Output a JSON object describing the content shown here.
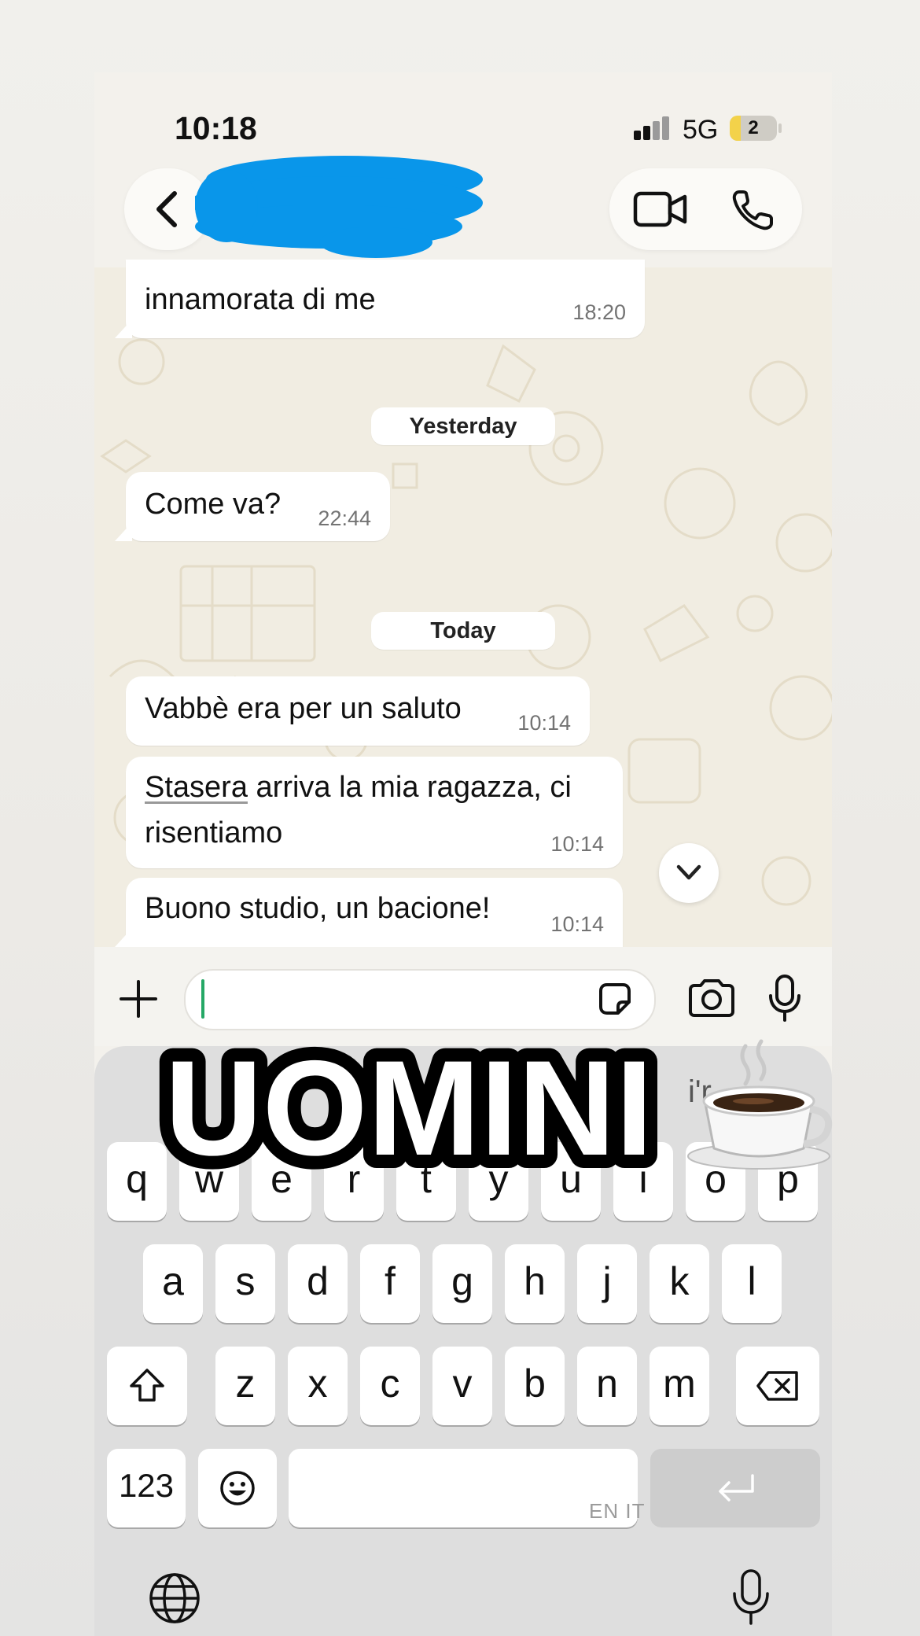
{
  "status_bar": {
    "time": "10:18",
    "network": "5G",
    "battery": "2"
  },
  "header": {
    "contact_name_redacted": true
  },
  "chat": {
    "messages": [
      {
        "text": "innamorata di me",
        "time": "18:20"
      },
      {
        "text": "Come va?",
        "time": "22:44"
      },
      {
        "text": "Vabbè era per un saluto",
        "time": "10:14"
      },
      {
        "text_underlined": "Stasera",
        "text_rest": " arriva la mia ragazza, ci",
        "text_line2": "risentiamo",
        "time": "10:14"
      },
      {
        "text": "Buono studio, un bacione!",
        "time": "10:14"
      }
    ],
    "date_separators": [
      "Yesterday",
      "Today"
    ]
  },
  "input": {
    "value": ""
  },
  "keyboard": {
    "row1": [
      "q",
      "w",
      "e",
      "r",
      "t",
      "y",
      "u",
      "i",
      "o",
      "p"
    ],
    "row2": [
      "a",
      "s",
      "d",
      "f",
      "g",
      "h",
      "j",
      "k",
      "l"
    ],
    "row3": [
      "z",
      "x",
      "c",
      "v",
      "b",
      "n",
      "m"
    ],
    "numbers_key": "123",
    "language_hint": "EN IT",
    "suggestion": "i'r"
  },
  "overlay": {
    "text": "UOMINI"
  },
  "colors": {
    "chat_background": "#f1ede2",
    "bubble": "#ffffff",
    "cursor": "#25a866",
    "redaction": "#0996ea"
  }
}
